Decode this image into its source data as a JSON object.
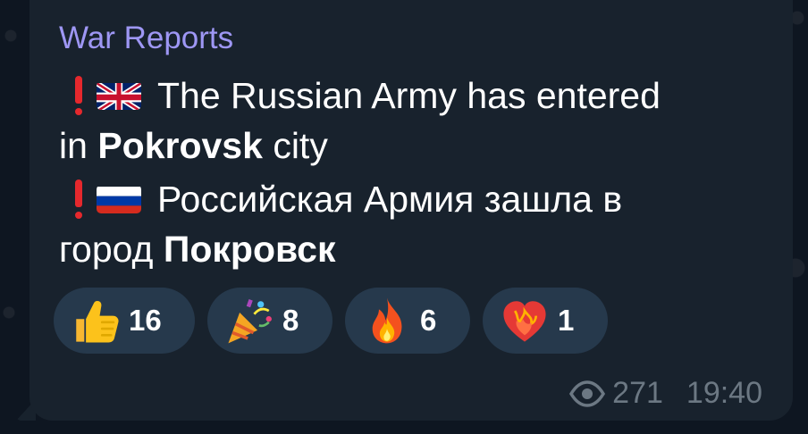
{
  "message": {
    "sender": "War Reports",
    "line1_prefix": "The Russian Army has entered",
    "line2_prefix": "in ",
    "line2_bold": "Pokrovsk",
    "line2_suffix": " city",
    "line3_prefix": "Российская Армия зашла в",
    "line4_prefix": "город ",
    "line4_bold": "Покровск"
  },
  "reactions": [
    {
      "emoji": "thumbs-up-icon",
      "count": "16"
    },
    {
      "emoji": "party-popper-icon",
      "count": "8"
    },
    {
      "emoji": "fire-icon",
      "count": "6"
    },
    {
      "emoji": "heart-on-fire-icon",
      "count": "1"
    }
  ],
  "meta": {
    "views": "271",
    "time": "19:40"
  },
  "colors": {
    "background": "#0e1621",
    "bubble": "#18222d",
    "sender": "#9e97f4",
    "reaction_bg": "#26394c",
    "meta": "#6c7883",
    "exclamation": "#e5282d"
  }
}
